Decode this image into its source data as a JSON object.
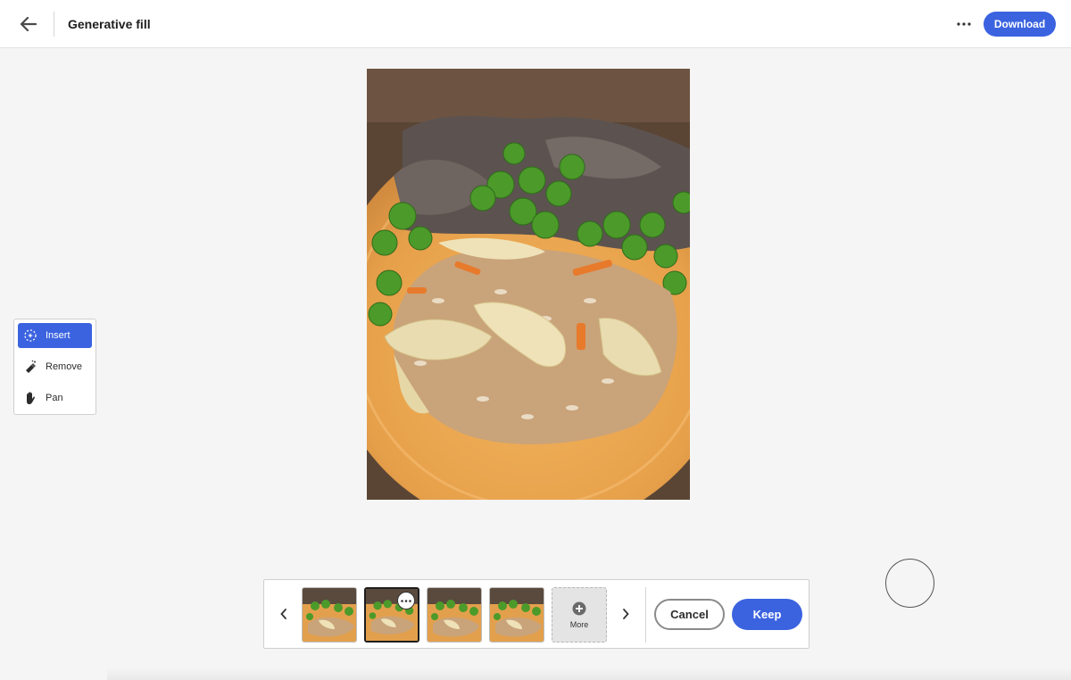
{
  "header": {
    "title": "Generative fill",
    "download_label": "Download",
    "back_icon": "arrow-left-icon",
    "more_icon": "ellipsis-icon"
  },
  "tools": [
    {
      "label": "Insert",
      "icon": "insert-sparkle-icon",
      "active": true
    },
    {
      "label": "Remove",
      "icon": "eraser-icon",
      "active": false
    },
    {
      "label": "Pan",
      "icon": "hand-icon",
      "active": false
    }
  ],
  "variations": {
    "count": 4,
    "selected_index": 1,
    "more_label": "More"
  },
  "actions": {
    "cancel_label": "Cancel",
    "keep_label": "Keep"
  },
  "colors": {
    "accent": "#3b63e0",
    "background": "#f5f5f5"
  }
}
